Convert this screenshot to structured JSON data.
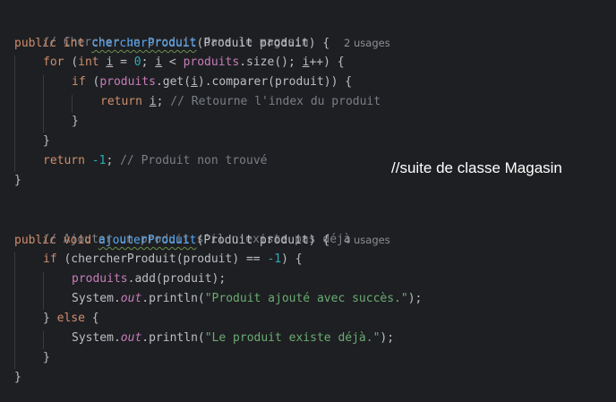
{
  "code": {
    "c1": "// Chercher un produit dans le magasin",
    "l2_kw": "public int ",
    "l2_m": "chercherProduit",
    "l2_rest": "(Produit produit) { ",
    "l2_usage": "2 usages",
    "l3_kw": "for ",
    "l3_a": "(",
    "l3_int": "int ",
    "l3_i1": "i",
    "l3_b": " = ",
    "l3_zero": "0",
    "l3_c": "; ",
    "l3_i2": "i",
    "l3_d": " < ",
    "l3_prod": "produits",
    "l3_e": ".size(); ",
    "l3_i3": "i",
    "l3_f": "++) {",
    "l4_kw": "if ",
    "l4_a": "(",
    "l4_prod": "produits",
    "l4_b": ".get(",
    "l4_i": "i",
    "l4_c": ").comparer(produit)) {",
    "l5_kw": "return ",
    "l5_i": "i",
    "l5_semi": "; ",
    "l5_cmt": "// Retourne l'index du produit",
    "l6": "}",
    "l7": "}",
    "l8_kw": "return ",
    "l8_num": "-1",
    "l8_semi": "; ",
    "l8_cmt": "// Produit non trouvé",
    "l9": "}",
    "c2": "// Ajouter un produit s'il n'existe pas déjà",
    "l11_kw": "public void ",
    "l11_m": "ajouterProduit",
    "l11_rest": "(Produit produit) { ",
    "l11_usage": "4 usages",
    "l12_kw": "if ",
    "l12_a": "(chercherProduit(produit) == ",
    "l12_num": "-1",
    "l12_b": ") {",
    "l13_prod": "produits",
    "l13_rest": ".add(produit);",
    "l14_a": "System.",
    "l14_out": "out",
    "l14_b": ".println(",
    "l14_str": "\"Produit ajouté avec succès.\"",
    "l14_c": ");",
    "l15_a": "} ",
    "l15_kw": "else",
    "l15_b": " {",
    "l16_a": "System.",
    "l16_out": "out",
    "l16_b": ".println(",
    "l16_str": "\"Le produit existe déjà.\"",
    "l16_c": ");",
    "l17": "}",
    "l18": "}"
  },
  "note": "//suite de classe Magasin",
  "colors": {
    "background": "#1e1f22",
    "keyword": "#cf8e6d",
    "comment": "#7a7e85",
    "method": "#56a8f5",
    "field": "#c77dbb",
    "number": "#2aacb8",
    "string": "#6aab73",
    "text": "#bcbec4"
  }
}
